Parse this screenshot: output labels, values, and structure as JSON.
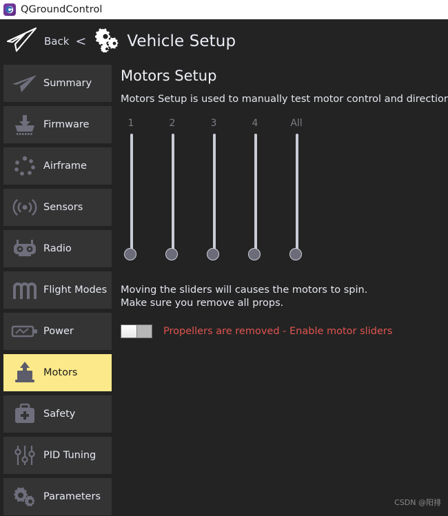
{
  "window": {
    "title": "QGroundControl",
    "app_icon": "qgroundcontrol-logo-icon"
  },
  "header": {
    "plane_icon": "paper-plane-icon",
    "back_label": "Back",
    "back_chevron": "<",
    "gears_icon": "gears-icon",
    "title": "Vehicle Setup"
  },
  "sidebar": {
    "items": [
      {
        "label": "Summary",
        "icon": "paper-plane-icon",
        "active": false
      },
      {
        "label": "Firmware",
        "icon": "download-icon",
        "active": false
      },
      {
        "label": "Airframe",
        "icon": "airframe-dots-icon",
        "active": false
      },
      {
        "label": "Sensors",
        "icon": "sensors-wave-icon",
        "active": false
      },
      {
        "label": "Radio",
        "icon": "radio-icon",
        "active": false
      },
      {
        "label": "Flight Modes",
        "icon": "flight-modes-icon",
        "active": false
      },
      {
        "label": "Power",
        "icon": "battery-icon",
        "active": false
      },
      {
        "label": "Motors",
        "icon": "motor-icon",
        "active": true
      },
      {
        "label": "Safety",
        "icon": "first-aid-kit-icon",
        "active": false
      },
      {
        "label": "PID Tuning",
        "icon": "sliders-icon",
        "active": false
      },
      {
        "label": "Parameters",
        "icon": "gears-icon",
        "active": false
      }
    ]
  },
  "main": {
    "title": "Motors Setup",
    "description": "Motors Setup is used to manually test motor control and direction.",
    "sliders": [
      {
        "label": "1",
        "value": 0
      },
      {
        "label": "2",
        "value": 0
      },
      {
        "label": "3",
        "value": 0
      },
      {
        "label": "4",
        "value": 0
      },
      {
        "label": "All",
        "value": 0
      }
    ],
    "warning_line1": "Moving the sliders will causes the motors to spin.",
    "warning_line2": "Make sure you remove all props.",
    "toggle": {
      "label": "Propellers are removed - Enable motor sliders",
      "checked": false
    }
  },
  "watermark": "CSDN @阳排",
  "colors": {
    "background": "#232323",
    "sidebar_item": "#343434",
    "active_item": "#fbe98a",
    "warning_text": "#e0544f",
    "slider_track": "#c9cbd6",
    "slider_handle": "#6b6b79",
    "icon_gray": "#6e6e7c"
  }
}
